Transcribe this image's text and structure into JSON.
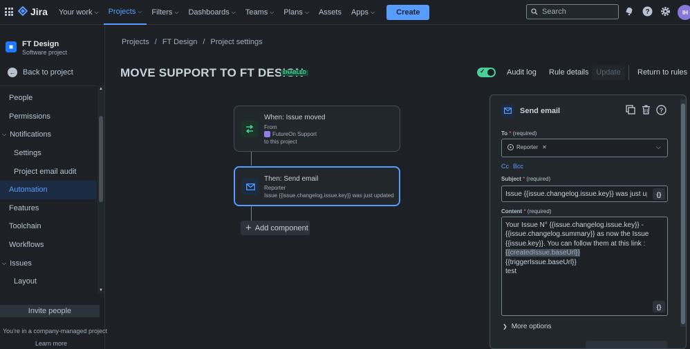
{
  "topnav": {
    "brand": "Jira",
    "items": [
      {
        "label": "Your work",
        "chevron": true,
        "active": false
      },
      {
        "label": "Projects",
        "chevron": true,
        "active": true
      },
      {
        "label": "Filters",
        "chevron": true,
        "active": false
      },
      {
        "label": "Dashboards",
        "chevron": true,
        "active": false
      },
      {
        "label": "Teams",
        "chevron": true,
        "active": false
      },
      {
        "label": "Plans",
        "chevron": true,
        "active": false
      },
      {
        "label": "Assets",
        "chevron": false,
        "active": false
      },
      {
        "label": "Apps",
        "chevron": true,
        "active": false
      }
    ],
    "create_label": "Create",
    "search_placeholder": "Search",
    "avatar_initials": "IH"
  },
  "sidebar": {
    "project_name": "FT Design",
    "project_type": "Software project",
    "back_label": "Back to project",
    "items": [
      {
        "label": "People",
        "kind": "item"
      },
      {
        "label": "Permissions",
        "kind": "item"
      },
      {
        "label": "Notifications",
        "kind": "group"
      },
      {
        "label": "Settings",
        "kind": "sub"
      },
      {
        "label": "Project email audit",
        "kind": "sub"
      },
      {
        "label": "Automation",
        "kind": "active"
      },
      {
        "label": "Features",
        "kind": "item"
      },
      {
        "label": "Toolchain",
        "kind": "item"
      },
      {
        "label": "Workflows",
        "kind": "item"
      },
      {
        "label": "Issues",
        "kind": "group"
      },
      {
        "label": "Layout",
        "kind": "sub"
      }
    ],
    "invite_label": "Invite people",
    "company_text": "You're in a company-managed project",
    "learn_more": "Learn more"
  },
  "breadcrumb": [
    "Projects",
    "FT Design",
    "Project settings"
  ],
  "rule": {
    "title": "MOVE SUPPORT TO FT DESIGN",
    "status": "ENABLED",
    "enabled": true
  },
  "header_actions": {
    "audit_log": "Audit log",
    "rule_details": "Rule details",
    "update": "Update",
    "return": "Return to rules"
  },
  "flow": {
    "trigger": {
      "title": "When: Issue moved",
      "line1": "From",
      "project": "FutureOn Support",
      "line3": "to this project"
    },
    "action": {
      "title": "Then: Send email",
      "line1": "Reporter",
      "line2": "Issue {{issue.changelog.issue.key}} was just updated"
    },
    "add_component": "Add component"
  },
  "panel": {
    "title": "Send email",
    "to_label": "To",
    "to_hint": "(required)",
    "to_chip": "Reporter",
    "cc": "Cc",
    "bcc": "Bcc",
    "subject_label": "Subject",
    "subject_hint": "(required)",
    "subject_value": "Issue {{issue.changelog.issue.key}} was just updatec",
    "content_label": "Content",
    "content_hint": "(required)",
    "content_lines": {
      "l1": "Your Issue N° {{issue.changelog.issue.key}} -",
      "l2": "{{issue.changelog.summary}} as now the Issue",
      "l3": "{{issue.key}}. You can follow them at this link :",
      "l4": "{{createdIssue.baseUrl}}",
      "l5": "{{triggerIssue.baseUrl}}",
      "l6": "test"
    },
    "brace_label": "{}",
    "more_options": "More options"
  },
  "colors": {
    "accent": "#579dff",
    "success": "#4bce97",
    "background": "#1d2125"
  }
}
